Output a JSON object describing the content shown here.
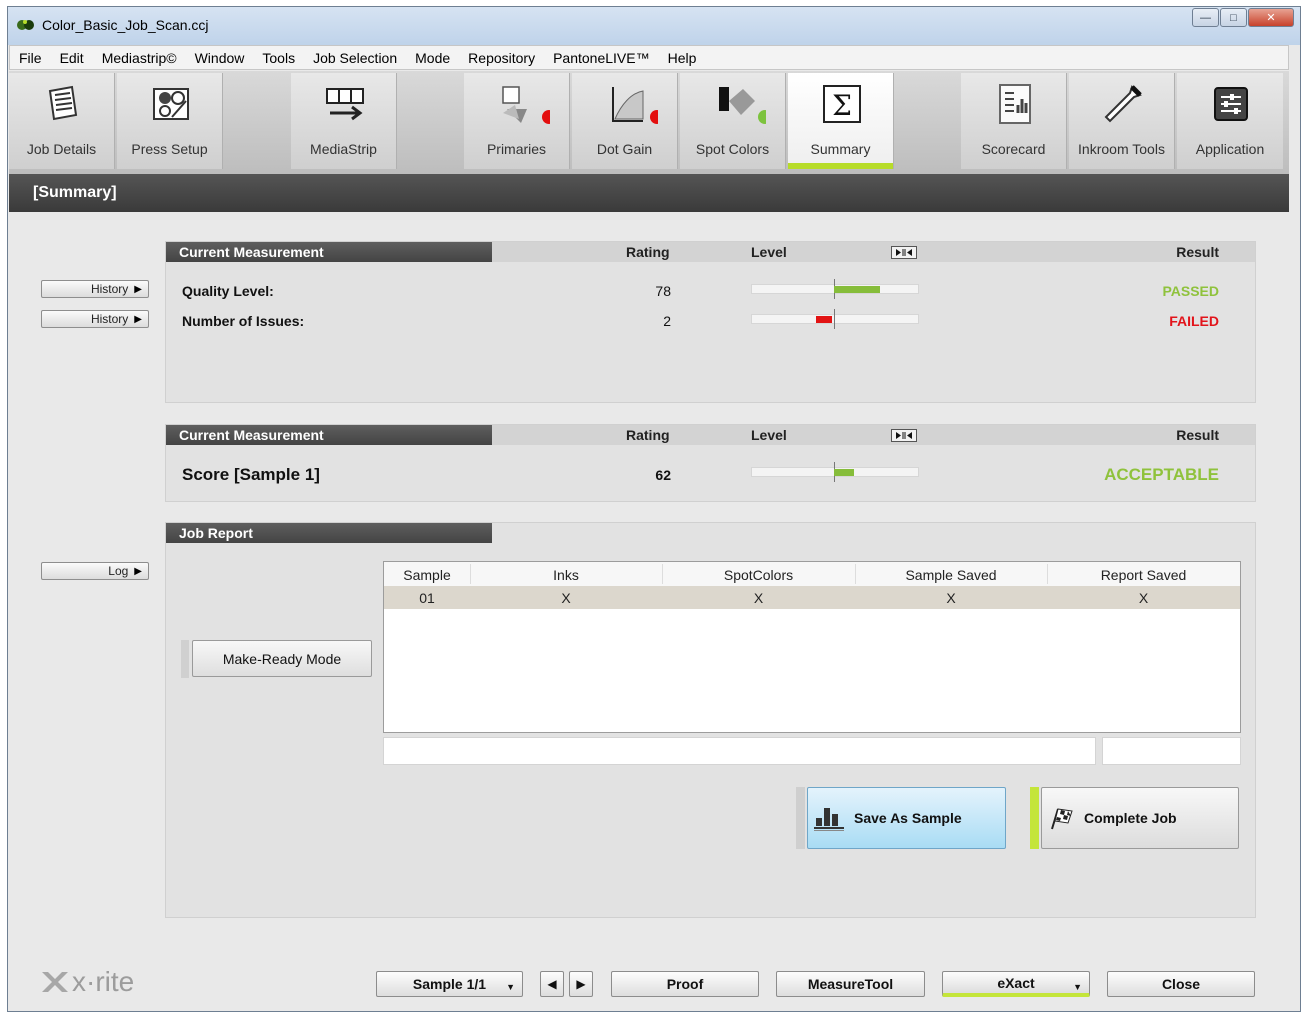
{
  "window": {
    "title": "Color_Basic_Job_Scan.ccj"
  },
  "menu": [
    "File",
    "Edit",
    "Mediastrip©",
    "Window",
    "Tools",
    "Job Selection",
    "Mode",
    "Repository",
    "PantoneLIVE™",
    "Help"
  ],
  "toolbar": {
    "items": [
      {
        "label": "Job Details",
        "icon": "document-icon"
      },
      {
        "label": "Press Setup",
        "icon": "press-setup-icon"
      },
      {
        "label": "MediaStrip",
        "icon": "mediastrip-icon"
      },
      {
        "label": "Primaries",
        "icon": "primaries-icon",
        "status": "red"
      },
      {
        "label": "Dot Gain",
        "icon": "dot-gain-icon",
        "status": "red"
      },
      {
        "label": "Spot Colors",
        "icon": "spot-colors-icon",
        "status": "green"
      },
      {
        "label": "Summary",
        "icon": "sigma-icon",
        "active": true
      },
      {
        "label": "Scorecard",
        "icon": "scorecard-icon"
      },
      {
        "label": "Inkroom Tools",
        "icon": "pipette-icon"
      },
      {
        "label": "Application",
        "icon": "settings-icon"
      }
    ]
  },
  "section_title": "[Summary]",
  "side_buttons": {
    "history1": "History",
    "history2": "History",
    "log": "Log"
  },
  "panel1": {
    "header": "Current Measurement",
    "col_rating": "Rating",
    "col_level": "Level",
    "col_result": "Result",
    "rows": [
      {
        "label": "Quality Level:",
        "rating": "78",
        "result": "PASSED",
        "result_color": "#8fc23c",
        "level_start": 0.5,
        "level_end": 0.78,
        "level_color": "#86bd3a"
      },
      {
        "label": "Number of Issues:",
        "rating": "2",
        "result": "FAILED",
        "result_color": "#e2141b",
        "level_start": 0.39,
        "level_end": 0.49,
        "level_color": "#e21414"
      }
    ]
  },
  "panel2": {
    "header": "Current Measurement",
    "col_rating": "Rating",
    "col_level": "Level",
    "col_result": "Result",
    "row": {
      "label": "Score [Sample 1]",
      "rating": "62",
      "result": "ACCEPTABLE",
      "result_color": "#8fc23c",
      "level_start": 0.5,
      "level_end": 0.62,
      "level_color": "#86bd3a"
    }
  },
  "job_report": {
    "header": "Job Report",
    "make_ready": "Make-Ready Mode",
    "columns": [
      "Sample",
      "Inks",
      "SpotColors",
      "Sample Saved",
      "Report Saved"
    ],
    "rows": [
      [
        "01",
        "X",
        "X",
        "X",
        "X"
      ]
    ],
    "save_as_sample": "Save As Sample",
    "complete_job": "Complete Job"
  },
  "bottom": {
    "logo": "x·rite",
    "sample_select": "Sample 1/1",
    "proof": "Proof",
    "measure_tool": "MeasureTool",
    "exact": "eXact",
    "close": "Close"
  }
}
